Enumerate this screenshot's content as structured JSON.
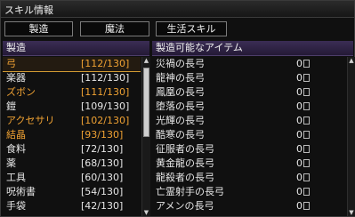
{
  "window": {
    "title": "スキル情報"
  },
  "tabs": [
    {
      "label": "製造"
    },
    {
      "label": "魔法"
    },
    {
      "label": "生活スキル"
    }
  ],
  "left_panel": {
    "header": "製造",
    "items": [
      {
        "name": "弓",
        "value": "[112/130]",
        "highlight": true,
        "selected": true
      },
      {
        "name": "楽器",
        "value": "[112/130]",
        "highlight": false
      },
      {
        "name": "ズボン",
        "value": "[111/130]",
        "highlight": true
      },
      {
        "name": "鎧",
        "value": "[109/130]",
        "highlight": false
      },
      {
        "name": "アクセサリ",
        "value": "[102/130]",
        "highlight": true
      },
      {
        "name": "結晶",
        "value": "[93/130]",
        "highlight": true
      },
      {
        "name": "食料",
        "value": "[72/130]",
        "highlight": false
      },
      {
        "name": "薬",
        "value": "[68/130]",
        "highlight": false
      },
      {
        "name": "工具",
        "value": "[60/130]",
        "highlight": false
      },
      {
        "name": "呪術書",
        "value": "[54/130]",
        "highlight": false
      },
      {
        "name": "手袋",
        "value": "[42/130]",
        "highlight": false
      }
    ]
  },
  "right_panel": {
    "header": "製造可能なアイテム",
    "items": [
      {
        "name": "災禍の長弓",
        "count": "0"
      },
      {
        "name": "龍神の長弓",
        "count": "0"
      },
      {
        "name": "鳳凰の長弓",
        "count": "0"
      },
      {
        "name": "堕落の長弓",
        "count": "0"
      },
      {
        "name": "光輝の長弓",
        "count": "0"
      },
      {
        "name": "酷寒の長弓",
        "count": "0"
      },
      {
        "name": "征服者の長弓",
        "count": "0"
      },
      {
        "name": "黄金龍の長弓",
        "count": "0"
      },
      {
        "name": "龍殺者の長弓",
        "count": "0"
      },
      {
        "name": "亡霊射手の長弓",
        "count": "0"
      },
      {
        "name": "アメンの長弓",
        "count": "0"
      }
    ]
  },
  "colors": {
    "highlight_text": "#f0a233",
    "header_bg": "#2e2244",
    "selection_border": "#d19a33"
  }
}
